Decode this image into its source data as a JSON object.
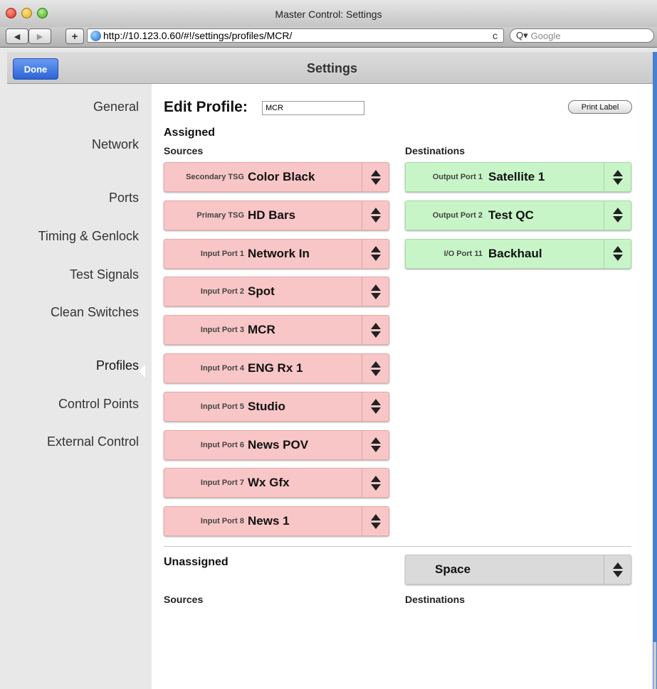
{
  "window": {
    "title": "Master Control: Settings"
  },
  "browser": {
    "url": "http://10.123.0.60/#!/settings/profiles/MCR/",
    "search_placeholder": "Google",
    "back_glyph": "◀",
    "forward_glyph": "▶",
    "add_glyph": "+",
    "reload_glyph": "c",
    "search_glyph": "Q▾"
  },
  "header": {
    "done_label": "Done",
    "title": "Settings"
  },
  "sidebar": {
    "items": [
      {
        "label": "General"
      },
      {
        "label": "Network"
      },
      {
        "label": "Ports"
      },
      {
        "label": "Timing & Genlock"
      },
      {
        "label": "Test Signals"
      },
      {
        "label": "Clean Switches"
      },
      {
        "label": "Profiles",
        "active": true
      },
      {
        "label": "Control Points"
      },
      {
        "label": "External Control"
      }
    ]
  },
  "profile": {
    "edit_label": "Edit Profile:",
    "name_value": "MCR",
    "print_label": "Print Label"
  },
  "assigned": {
    "heading": "Assigned",
    "sources_heading": "Sources",
    "destinations_heading": "Destinations",
    "sources": [
      {
        "port": "Secondary TSG",
        "name": "Color Black"
      },
      {
        "port": "Primary TSG",
        "name": "HD Bars"
      },
      {
        "port": "Input Port 1",
        "name": "Network In"
      },
      {
        "port": "Input Port 2",
        "name": "Spot"
      },
      {
        "port": "Input Port 3",
        "name": "MCR"
      },
      {
        "port": "Input Port 4",
        "name": "ENG Rx 1"
      },
      {
        "port": "Input Port 5",
        "name": "Studio"
      },
      {
        "port": "Input Port 6",
        "name": "News POV"
      },
      {
        "port": "Input Port 7",
        "name": "Wx Gfx"
      },
      {
        "port": "Input Port 8",
        "name": "News 1"
      }
    ],
    "destinations": [
      {
        "port": "Output Port 1",
        "name": "Satellite 1"
      },
      {
        "port": "Output Port 2",
        "name": "Test QC"
      },
      {
        "port": "I/O Port 11",
        "name": "Backhaul"
      }
    ]
  },
  "unassigned": {
    "heading": "Unassigned",
    "sources_heading": "Sources",
    "destinations_heading": "Destinations",
    "space_label": "Space"
  },
  "colors": {
    "source": "#f8c6c6",
    "destination": "#c8f5c8",
    "accent": "#2d63d6"
  }
}
